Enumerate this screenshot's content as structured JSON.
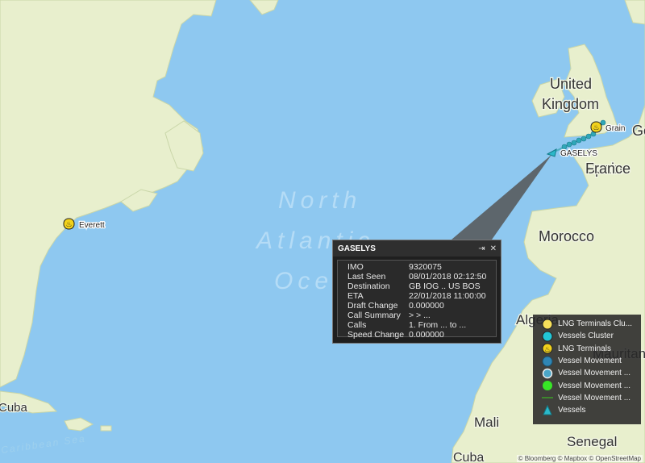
{
  "map": {
    "ocean_labels": [
      "North",
      "Atlantic",
      "Ocean"
    ],
    "country_labels": [
      "United Kingdom",
      "France",
      "Spain",
      "Morocco",
      "Algeria",
      "Mauritania",
      "Mali",
      "Senegal",
      "Cuba",
      "Ge"
    ],
    "caribbean_label": "Caribbean Sea",
    "terminals": [
      {
        "name": "Everett"
      },
      {
        "name": "Grain"
      }
    ],
    "vessel_label": "GASELYS"
  },
  "popup": {
    "title": "GASELYS",
    "rows": [
      {
        "key": "IMO",
        "value": "9320075"
      },
      {
        "key": "Last Seen",
        "value": "08/01/2018 02:12:50"
      },
      {
        "key": "Destination",
        "value": "GB IOG .. US BOS"
      },
      {
        "key": "ETA",
        "value": "22/01/2018 11:00:00"
      },
      {
        "key": "Draft Change",
        "value": "0.000000"
      },
      {
        "key": "Call Summary",
        "value": " > > ..."
      },
      {
        "key": "Calls",
        "value": " 1. From ... to ..."
      },
      {
        "key": "Speed Change",
        "value": "0.000000"
      }
    ]
  },
  "legend": {
    "items": [
      {
        "label": "LNG Terminals Clu...",
        "icon": "yellow-circle-icon",
        "color": "#f7e05a"
      },
      {
        "label": "Vessels Cluster",
        "icon": "cyan-circle-icon",
        "color": "#22c7d6"
      },
      {
        "label": "LNG Terminals",
        "icon": "lng-terminal-icon",
        "color": "#f2d21b"
      },
      {
        "label": "Vessel Movement",
        "icon": "teal-circle-icon",
        "color": "#2f86b5"
      },
      {
        "label": "Vessel Movement ...",
        "icon": "ring-circle-icon",
        "color": "#4aa6c8"
      },
      {
        "label": "Vessel Movement ...",
        "icon": "green-circle-icon",
        "color": "#37e626"
      },
      {
        "label": "Vessel Movement ...",
        "icon": "green-line-icon",
        "color": "#3c9e28"
      },
      {
        "label": "Vessels",
        "icon": "vessel-arrow-icon",
        "color": "#2bb8c9"
      }
    ]
  },
  "credit": "© Bloomberg © Mapbox © OpenStreetMap"
}
